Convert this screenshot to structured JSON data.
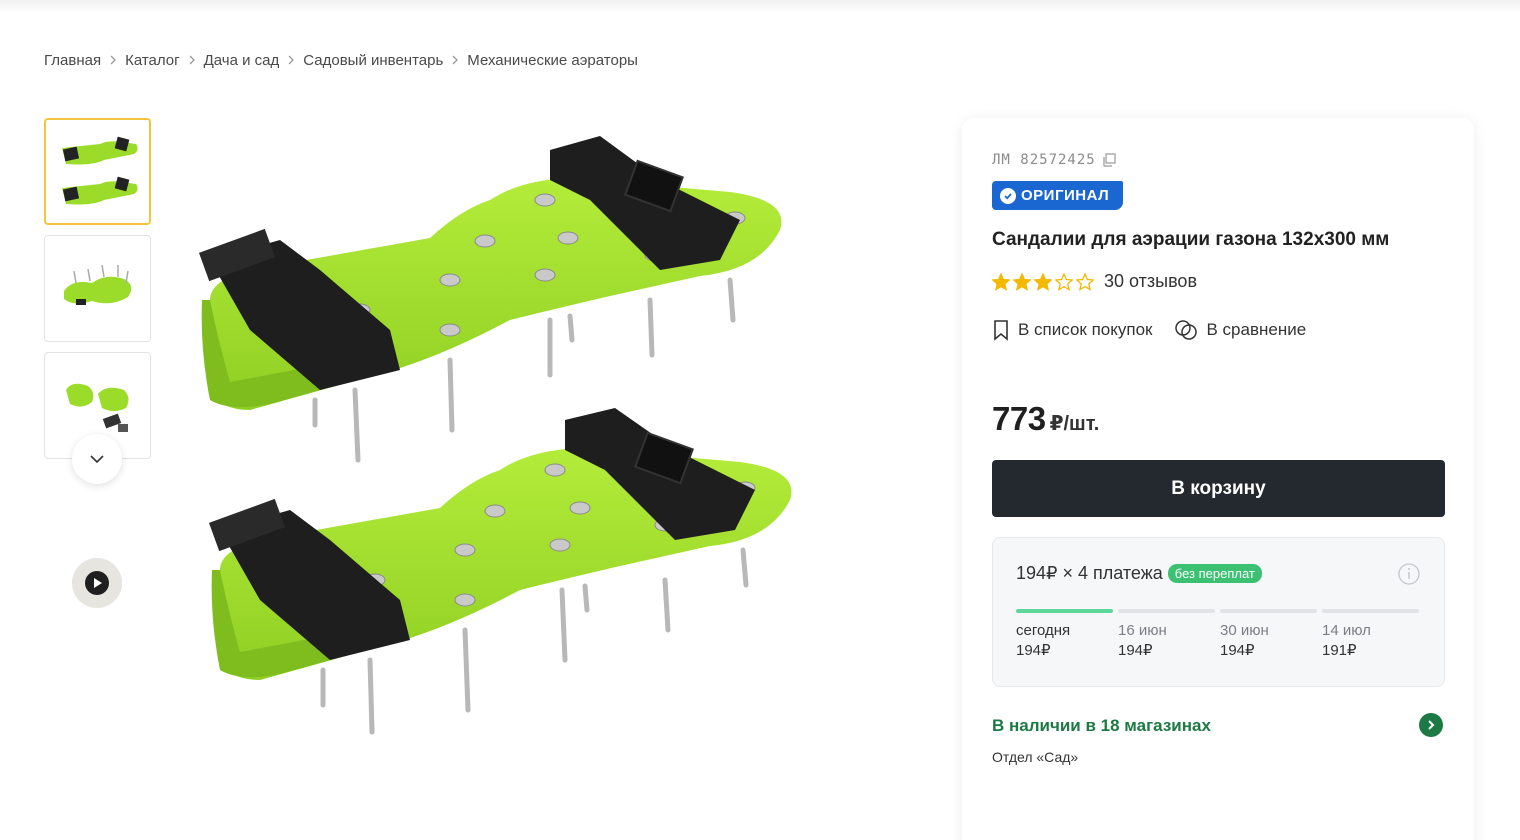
{
  "breadcrumb": [
    "Главная",
    "Каталог",
    "Дача и сад",
    "Садовый инвентарь",
    "Механические аэраторы"
  ],
  "gallery": {
    "thumbnails": [
      "два сандаля сверху",
      "сандаль снизу",
      "комплект"
    ],
    "icons": {
      "scroll": "chevron-down-icon",
      "video": "play-icon"
    }
  },
  "product": {
    "sku": "ЛМ 82572425",
    "badge": "ОРИГИНАЛ",
    "title": "Сандалии для аэрации газона 132х300 мм",
    "rating": 3,
    "rating_max": 5,
    "reviews": "30 отзывов",
    "shopping_list": "В список покупок",
    "compare": "В сравнение",
    "price": "773",
    "price_unit": "₽/шт.",
    "cart_button": "В корзину"
  },
  "installment": {
    "headline": "194₽ × 4 платежа",
    "tag": "без переплат",
    "payments": [
      {
        "date": "сегодня",
        "amount": "194₽"
      },
      {
        "date": "16 июн",
        "amount": "194₽"
      },
      {
        "date": "30 июн",
        "amount": "194₽"
      },
      {
        "date": "14 июл",
        "amount": "191₽"
      }
    ],
    "progress_paid": 1
  },
  "availability": {
    "stock": "В наличии в 18 магазинах",
    "department": "Отдел «Сад»"
  },
  "colors": {
    "accent_dark": "#23292f",
    "badge_blue": "#1a67d2",
    "green": "#1d7a45",
    "star": "#f5b800",
    "thumb_active": "#f2c53d",
    "product_green": "#9bdc2a"
  }
}
